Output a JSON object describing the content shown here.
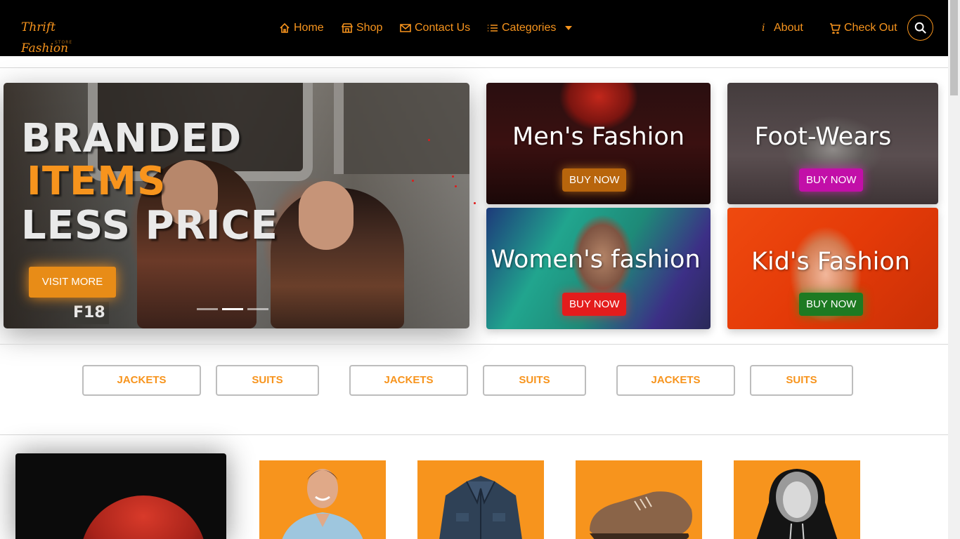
{
  "brand": {
    "logo_text": "Thrift Fashion",
    "logo_sub": "STORE"
  },
  "nav": {
    "links": [
      {
        "label": "Home",
        "icon": "home-icon"
      },
      {
        "label": "Shop",
        "icon": "shop-icon"
      },
      {
        "label": "Contact Us",
        "icon": "envelope-icon"
      },
      {
        "label": "Categories",
        "icon": "list-icon"
      }
    ],
    "right_links": [
      {
        "label": "About",
        "icon": "info-icon"
      },
      {
        "label": "Check Out",
        "icon": "cart-icon"
      }
    ],
    "search_icon": "search-icon"
  },
  "hero": {
    "line1": "BRANDED",
    "line2": "ITEMS",
    "line3": "LESS PRICE",
    "button": "VISIT MORE",
    "plate": "F18",
    "slides": 3,
    "active_slide": 1
  },
  "categories": [
    {
      "title": "Men's Fashion",
      "button": "BUY NOW",
      "button_color": "#b8650c"
    },
    {
      "title": "Foot-Wears",
      "button": "BUY NOW",
      "button_color": "#c20fa8"
    },
    {
      "title": "Women's fashion",
      "button": "BUY NOW",
      "button_color": "#e41c1c"
    },
    {
      "title": "Kid's Fashion",
      "button": "BUY NOW",
      "button_color": "#1d7a22"
    }
  ],
  "tags": [
    "JACKETS",
    "SUITS",
    "JACKETS",
    "SUITS",
    "JACKETS",
    "SUITS"
  ],
  "colors": {
    "accent": "#f7941d",
    "navbar": "#000000"
  },
  "products": [
    {
      "image": "man-in-shirt"
    },
    {
      "image": "denim-jacket"
    },
    {
      "image": "brown-shoe"
    },
    {
      "image": "black-hoodie"
    }
  ]
}
